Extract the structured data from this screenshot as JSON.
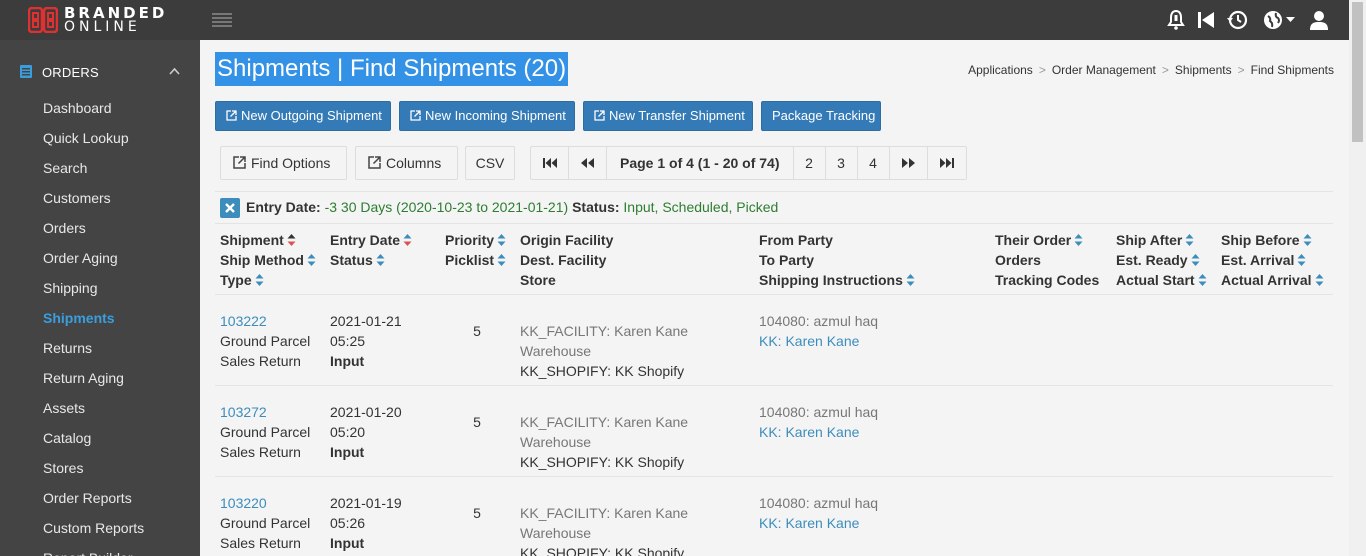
{
  "app": {
    "logo_line1": "BRANDED",
    "logo_line2": "ONLINE",
    "brand_color": "#e03030"
  },
  "top_icons": [
    "bell-icon",
    "skip-back-icon",
    "history-icon",
    "globe-icon",
    "user-icon"
  ],
  "sidebar": {
    "section_label": "ORDERS",
    "items": [
      {
        "label": "Dashboard"
      },
      {
        "label": "Quick Lookup"
      },
      {
        "label": "Search"
      },
      {
        "label": "Customers"
      },
      {
        "label": "Orders"
      },
      {
        "label": "Order Aging"
      },
      {
        "label": "Shipping"
      },
      {
        "label": "Shipments"
      },
      {
        "label": "Returns"
      },
      {
        "label": "Return Aging"
      },
      {
        "label": "Assets"
      },
      {
        "label": "Catalog"
      },
      {
        "label": "Stores"
      },
      {
        "label": "Order Reports"
      },
      {
        "label": "Custom Reports"
      },
      {
        "label": "Report Builder"
      }
    ],
    "active_label": "Shipments"
  },
  "header": {
    "title": "Shipments | Find Shipments (20)",
    "breadcrumb": [
      "Applications",
      "Order Management",
      "Shipments",
      "Find Shipments"
    ]
  },
  "actions": {
    "new_outgoing": "New Outgoing Shipment",
    "new_incoming": "New Incoming Shipment",
    "new_transfer": "New Transfer Shipment",
    "package_tracking": "Package Tracking"
  },
  "toolbar": {
    "find_options": "Find Options",
    "columns": "Columns",
    "csv": "CSV"
  },
  "pager": {
    "page_info": "Page 1 of 4 (1 - 20 of 74)",
    "pages": [
      "2",
      "3",
      "4"
    ]
  },
  "filter": {
    "entry_date_label": "Entry Date:",
    "entry_date_value": "-3 30 Days (2020-10-23 to 2021-01-21)",
    "status_label": "Status:",
    "status_value": "Input, Scheduled, Picked"
  },
  "columns": {
    "col1": [
      "Shipment",
      "Ship Method",
      "Type"
    ],
    "col2": [
      "Entry Date",
      "Status"
    ],
    "col3": [
      "Priority",
      "Picklist"
    ],
    "col4": [
      "Origin Facility",
      "Dest. Facility",
      "Store"
    ],
    "col5": [
      "From Party",
      "To Party",
      "Shipping Instructions"
    ],
    "col6": [
      "Their Order",
      "Orders",
      "Tracking Codes"
    ],
    "col7": [
      "Ship After",
      "Est. Ready",
      "Actual Start"
    ],
    "col8": [
      "Ship Before",
      "Est. Arrival",
      "Actual Arrival"
    ]
  },
  "rows": [
    {
      "shipment_id": "103222",
      "ship_method": "Ground Parcel",
      "type": "Sales Return",
      "entry_date": "2021-01-21",
      "entry_time": "05:25",
      "status": "Input",
      "priority": "5",
      "origin_facility_1": "KK_FACILITY: Karen Kane",
      "origin_facility_2": "Warehouse",
      "store": "KK_SHOPIFY: KK Shopify",
      "from_party": "104080: azmul haq",
      "to_party": "KK: Karen Kane"
    },
    {
      "shipment_id": "103272",
      "ship_method": "Ground Parcel",
      "type": "Sales Return",
      "entry_date": "2021-01-20",
      "entry_time": "05:20",
      "status": "Input",
      "priority": "5",
      "origin_facility_1": "KK_FACILITY: Karen Kane",
      "origin_facility_2": "Warehouse",
      "store": "KK_SHOPIFY: KK Shopify",
      "from_party": "104080: azmul haq",
      "to_party": "KK: Karen Kane"
    },
    {
      "shipment_id": "103220",
      "ship_method": "Ground Parcel",
      "type": "Sales Return",
      "entry_date": "2021-01-19",
      "entry_time": "05:26",
      "status": "Input",
      "priority": "5",
      "origin_facility_1": "KK_FACILITY: Karen Kane",
      "origin_facility_2": "Warehouse",
      "store": "KK_SHOPIFY: KK Shopify",
      "from_party": "104080: azmul haq",
      "to_party": "KK: Karen Kane"
    }
  ]
}
